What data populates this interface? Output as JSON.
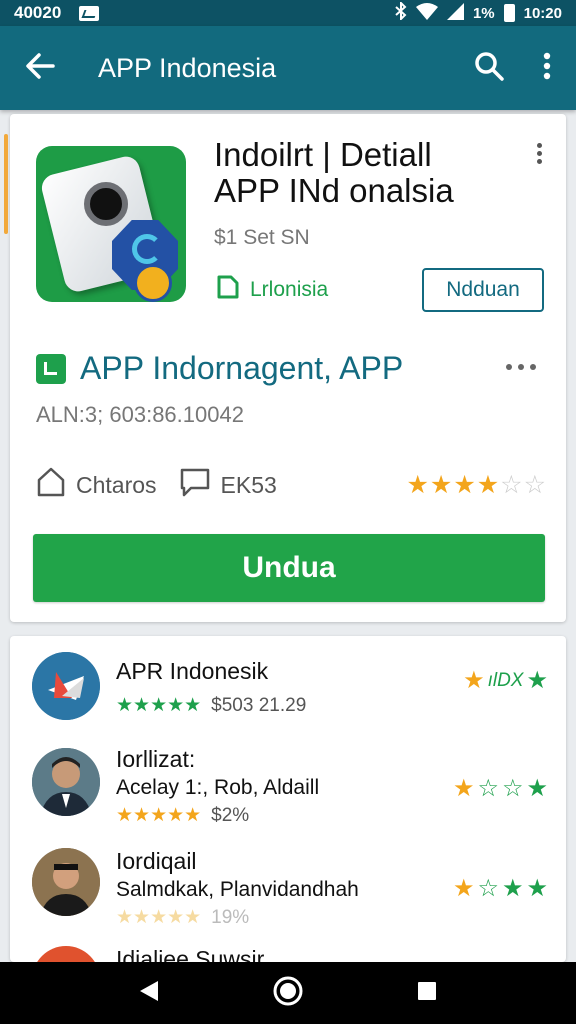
{
  "status_bar": {
    "left_text": "40020",
    "battery": "1%",
    "time": "10:20"
  },
  "app_bar": {
    "title": "APP Indonesia",
    "back_icon": "arrow-left-icon",
    "search_icon": "search-icon",
    "menu_icon": "more-vert-icon"
  },
  "detail": {
    "title_line1": "Indoilrt | Detiall",
    "title_line2": "APP INd onalsia",
    "price": "$1 Set SN",
    "developer": "Lrlonisia",
    "outline_button": "Ndduan",
    "sub_title": "APP Indornagent, APP",
    "sub_meta": "ALN:3; 603:86.10042",
    "stat1": "Chtaros",
    "stat2": "EK53",
    "rating_stars": 3.5,
    "install_button": "Undua",
    "accent_color": "#21a449",
    "brand_color": "#126a7e"
  },
  "list": {
    "items": [
      {
        "title": "APR Indonesik",
        "meta": "$503 21.29",
        "right_text": "ılDX"
      },
      {
        "title": "Iorllizat:",
        "sub": "Acelay 1:, Rob, Aldaill",
        "meta": "$2%"
      },
      {
        "title": "Iordiqail",
        "sub": "Salmdkak, Planvidandhah",
        "meta": "19%"
      },
      {
        "title": "Idialiee Suwsir"
      }
    ]
  },
  "nav_bar": {
    "back_icon": "nav-back-icon",
    "home_icon": "nav-home-icon",
    "recents_icon": "nav-recents-icon"
  }
}
